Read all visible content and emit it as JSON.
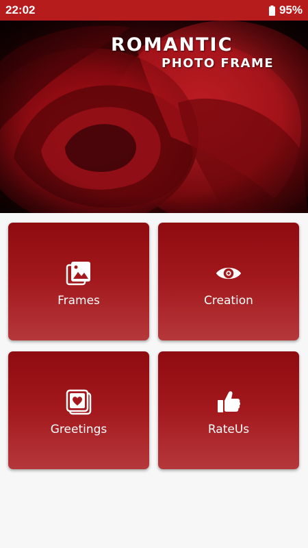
{
  "status_bar": {
    "time": "22:02",
    "battery": "95%",
    "battery_level": 0.95,
    "background_color": "#b71c1c"
  },
  "banner": {
    "title": "ROMANTIC",
    "subtitle": "PHOTO FRAME"
  },
  "tiles": [
    {
      "label": "Frames",
      "icon": "image-gallery-icon"
    },
    {
      "label": "Creation",
      "icon": "eye-icon"
    },
    {
      "label": "Greetings",
      "icon": "heart-card-icon"
    },
    {
      "label": "RateUs",
      "icon": "thumbs-up-icon"
    }
  ],
  "colors": {
    "accent": "#b71c1c",
    "tile_top": "#8e0b0f",
    "tile_bottom": "#b5383b",
    "page_background": "#f7f7f7"
  }
}
